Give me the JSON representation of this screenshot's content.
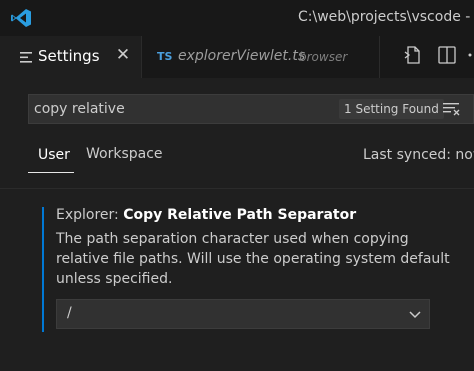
{
  "titlebar": {
    "title": "C:\\web\\projects\\vscode - Vis"
  },
  "tabs": [
    {
      "label": "Settings",
      "icon": "settings-editor-icon",
      "close": "✕"
    },
    {
      "badge": "TS",
      "label": "explorerViewlet.ts",
      "description": "browser"
    }
  ],
  "search": {
    "value": "copy relative",
    "count": "1 Setting Found"
  },
  "scopes": {
    "user": "User",
    "workspace": "Workspace",
    "last_synced": "Last synced: now"
  },
  "setting": {
    "category": "Explorer: ",
    "name": "Copy Relative Path Separator",
    "description": "The path separation character used when copying relative file paths. Will use the operating system default unless specified.",
    "value": "/"
  },
  "colors": {
    "accent": "#0078d4",
    "ts_badge": "#4b9fdd",
    "background": "#1f1f1f"
  }
}
